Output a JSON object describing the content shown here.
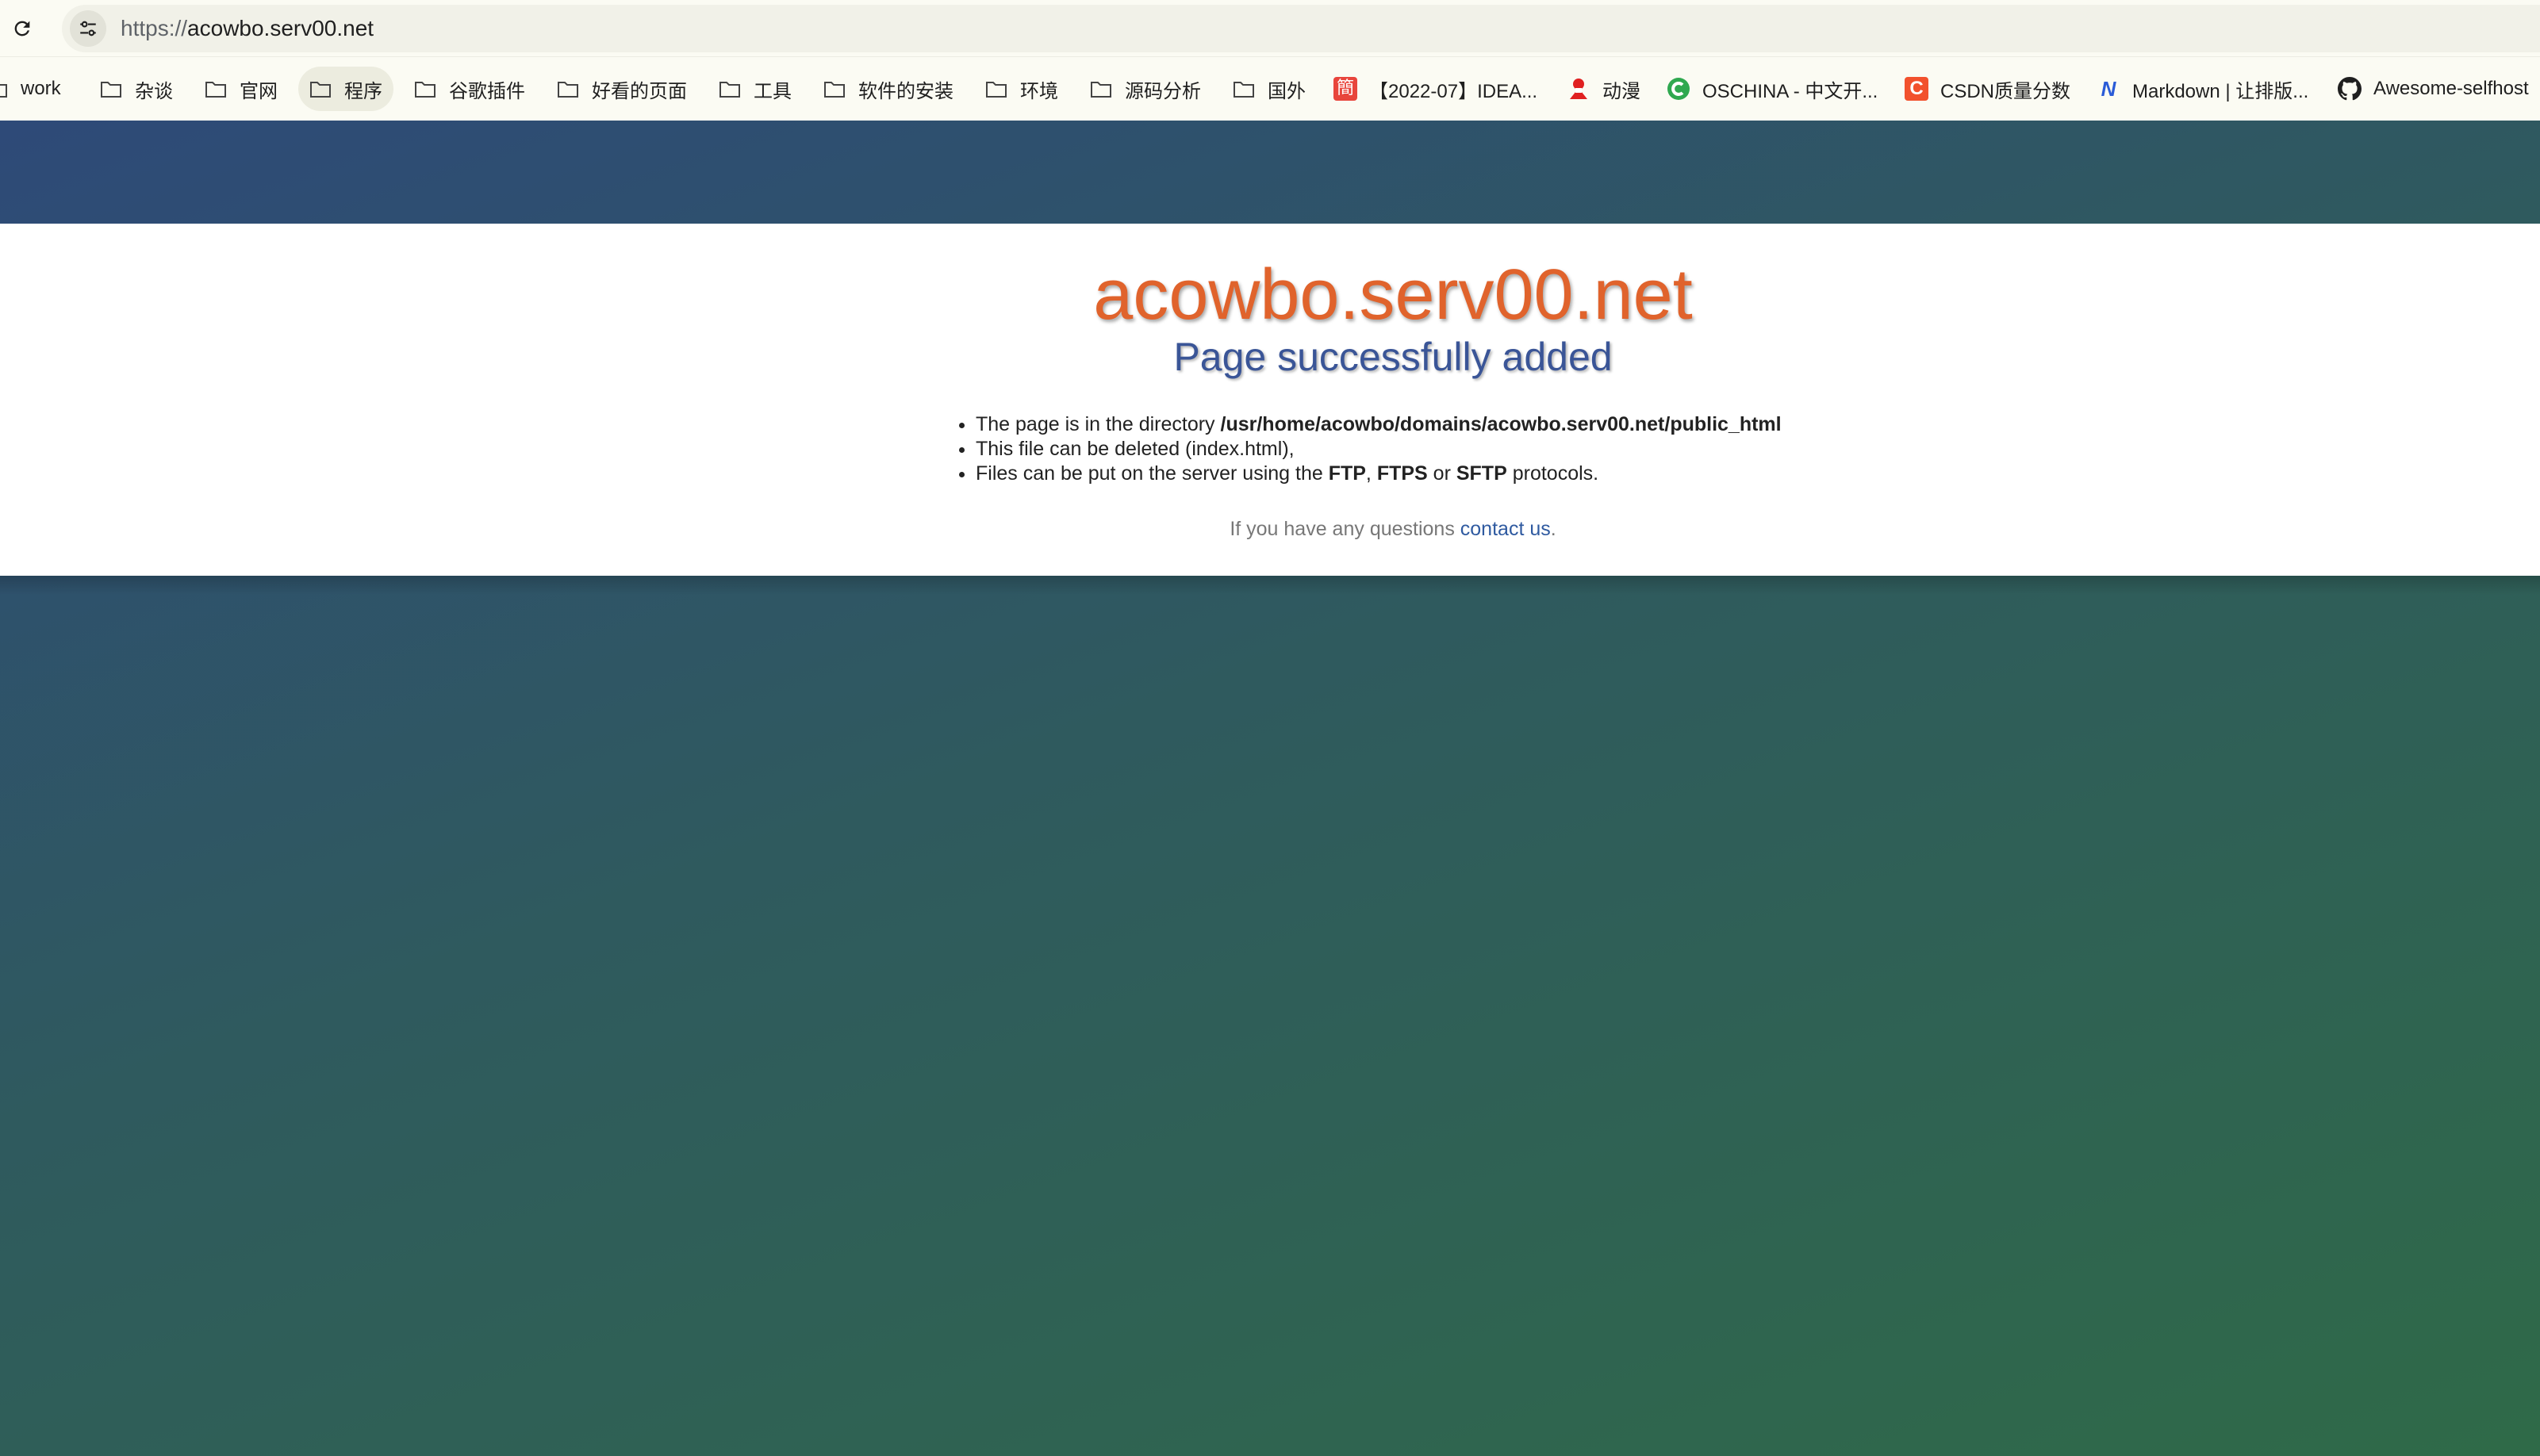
{
  "browser": {
    "url_scheme": "https://",
    "url_host": "acowbo.serv00.net"
  },
  "bookmarks": [
    {
      "label": "work",
      "icon": "folder-icon"
    },
    {
      "label": "杂谈",
      "icon": "folder-icon"
    },
    {
      "label": "官网",
      "icon": "folder-icon"
    },
    {
      "label": "程序",
      "icon": "folder-icon"
    },
    {
      "label": "谷歌插件",
      "icon": "folder-icon"
    },
    {
      "label": "好看的页面",
      "icon": "folder-icon"
    },
    {
      "label": "工具",
      "icon": "folder-icon"
    },
    {
      "label": "软件的安装",
      "icon": "folder-icon"
    },
    {
      "label": "环境",
      "icon": "folder-icon"
    },
    {
      "label": "源码分析",
      "icon": "folder-icon"
    },
    {
      "label": "国外",
      "icon": "folder-icon"
    },
    {
      "label": "【2022-07】IDEA...",
      "icon": "jian-favicon-icon"
    },
    {
      "label": "动漫",
      "icon": "anime-favicon-icon"
    },
    {
      "label": "OSCHINA - 中文开...",
      "icon": "oschina-favicon-icon"
    },
    {
      "label": "CSDN质量分数",
      "icon": "csdn-favicon-icon"
    },
    {
      "label": "Markdown | 让排版...",
      "icon": "markdown-favicon-icon"
    },
    {
      "label": "Awesome-selfhost",
      "icon": "github-icon"
    }
  ],
  "page": {
    "title": "acowbo.serv00.net",
    "subtitle": "Page successfully added",
    "list": {
      "item1_text": "The page is in the directory ",
      "item1_path": "/usr/home/acowbo/domains/acowbo.serv00.net/public_html",
      "item2_text": "This file can be deleted (index.html),",
      "item3_prefix": "Files can be put on the server using the ",
      "item3_ftp": "FTP",
      "item3_sep1": ", ",
      "item3_ftps": "FTPS",
      "item3_sep2": " or ",
      "item3_sftp": "SFTP",
      "item3_suffix": " protocols."
    },
    "questions_text": "If you have any questions ",
    "contact_link": "contact us",
    "questions_end": "."
  },
  "colors": {
    "title": "#e0632c",
    "subtitle": "#3a5597",
    "link": "#2f5aa0",
    "gradient_start": "#2e4a78",
    "gradient_end": "#2f6a48"
  }
}
